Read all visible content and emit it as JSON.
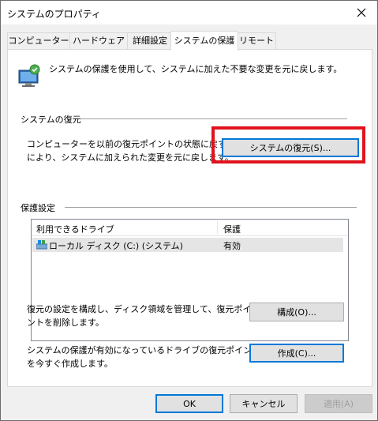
{
  "window": {
    "title": "システムのプロパティ"
  },
  "tabs": [
    {
      "label": "コンピューター名"
    },
    {
      "label": "ハードウェア"
    },
    {
      "label": "詳細設定"
    },
    {
      "label": "システムの保護"
    },
    {
      "label": "リモート"
    }
  ],
  "header": {
    "description": "システムの保護を使用して、システムに加えた不要な変更を元に戻します。"
  },
  "restore": {
    "section_title": "システムの復元",
    "description_line1": "コンピューターを以前の復元ポイントの状態に戻すこと",
    "description_line2": "により、システムに加えられた変更を元に戻します。",
    "button_label": "システムの復元(S)..."
  },
  "protection": {
    "section_title": "保護設定",
    "columns": [
      "利用できるドライブ",
      "保護"
    ],
    "rows": [
      {
        "drive": "ローカル ディスク (C:) (システム)",
        "status": "有効"
      }
    ],
    "configure_text_line1": "復元の設定を構成し、ディスク領域を管理して、復元ポイ",
    "configure_text_line2": "ントを削除します。",
    "configure_button": "構成(O)...",
    "create_text_line1": "システムの保護が有効になっているドライブの復元ポイント",
    "create_text_line2": "を今すぐ作成します。",
    "create_button": "作成(C)..."
  },
  "footer": {
    "ok": "OK",
    "cancel": "キャンセル",
    "apply": "適用(A)"
  },
  "colors": {
    "highlight": "#e0141e",
    "accent": "#0078d7"
  }
}
